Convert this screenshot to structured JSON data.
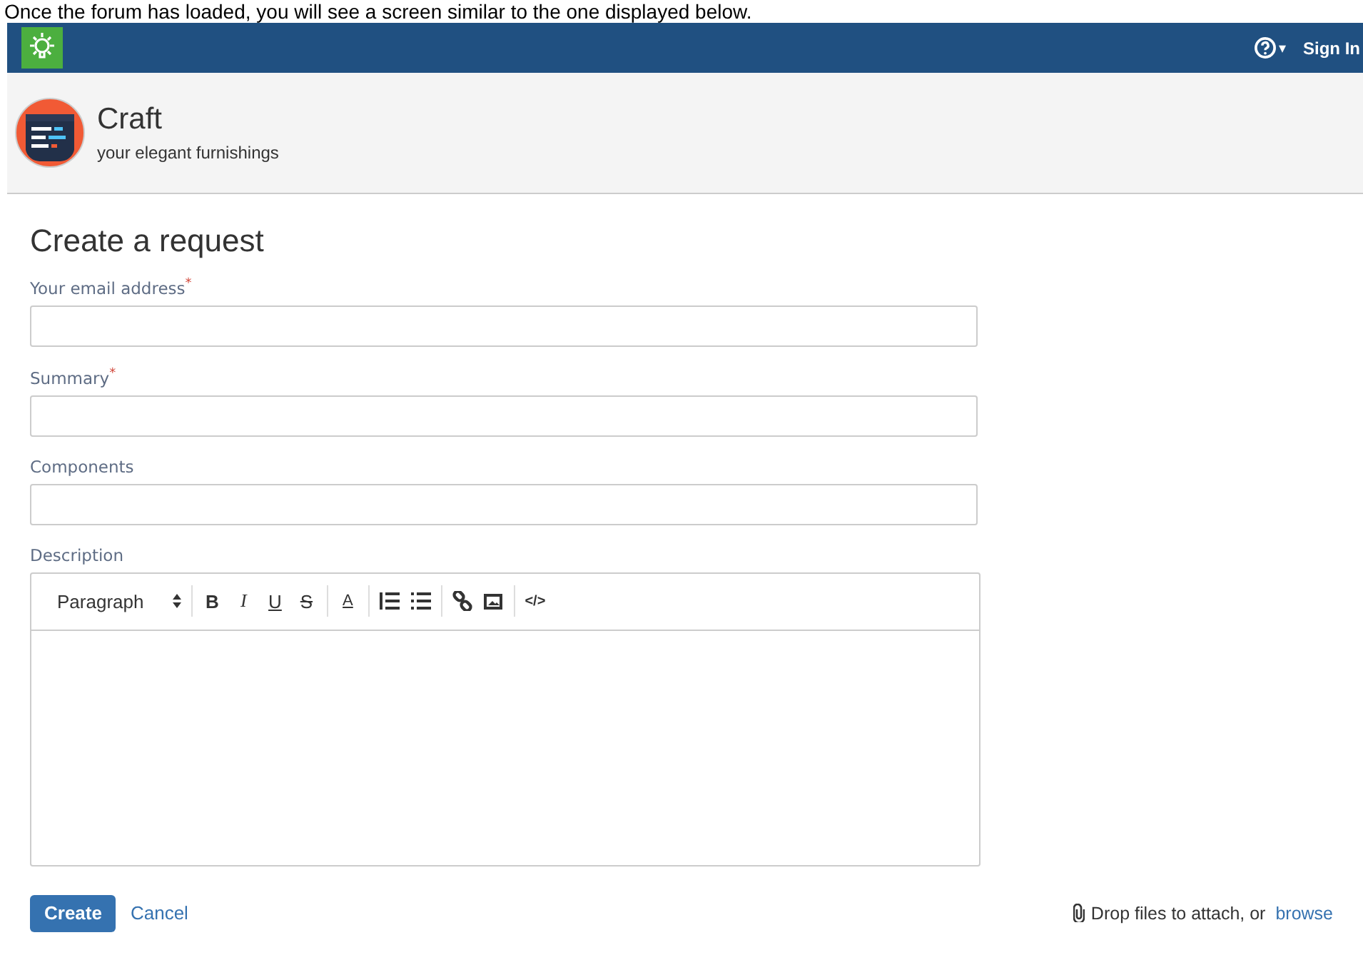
{
  "caption": "Once the forum has loaded, you will see a screen similar to the one displayed below.",
  "topbar": {
    "help_caret": "▾",
    "sign_in": "Sign In"
  },
  "portal": {
    "name": "Craft",
    "tagline": "your elegant furnishings"
  },
  "form": {
    "title": "Create a request",
    "required_marker": "*",
    "fields": [
      {
        "label": "Your email address",
        "required": true,
        "kind": "input"
      },
      {
        "label": "Summary",
        "required": true,
        "kind": "input"
      },
      {
        "label": "Components",
        "required": false,
        "kind": "input"
      },
      {
        "label": "Description",
        "required": false,
        "kind": "editor"
      }
    ],
    "toolbar": [
      {
        "kind": "select",
        "label": "Paragraph"
      },
      {
        "kind": "sep"
      },
      {
        "kind": "bold",
        "label": "B"
      },
      {
        "kind": "italic",
        "label": "I"
      },
      {
        "kind": "underline",
        "label": "U"
      },
      {
        "kind": "strike",
        "label": "S"
      },
      {
        "kind": "sep"
      },
      {
        "kind": "color",
        "label": "A"
      },
      {
        "kind": "sep"
      },
      {
        "kind": "numbered"
      },
      {
        "kind": "bulleted"
      },
      {
        "kind": "sep"
      },
      {
        "kind": "link"
      },
      {
        "kind": "image"
      },
      {
        "kind": "sep"
      },
      {
        "kind": "code",
        "label": "</>"
      }
    ],
    "create": "Create",
    "cancel": "Cancel",
    "drop_text": "Drop files to attach, or",
    "browse": "browse"
  }
}
